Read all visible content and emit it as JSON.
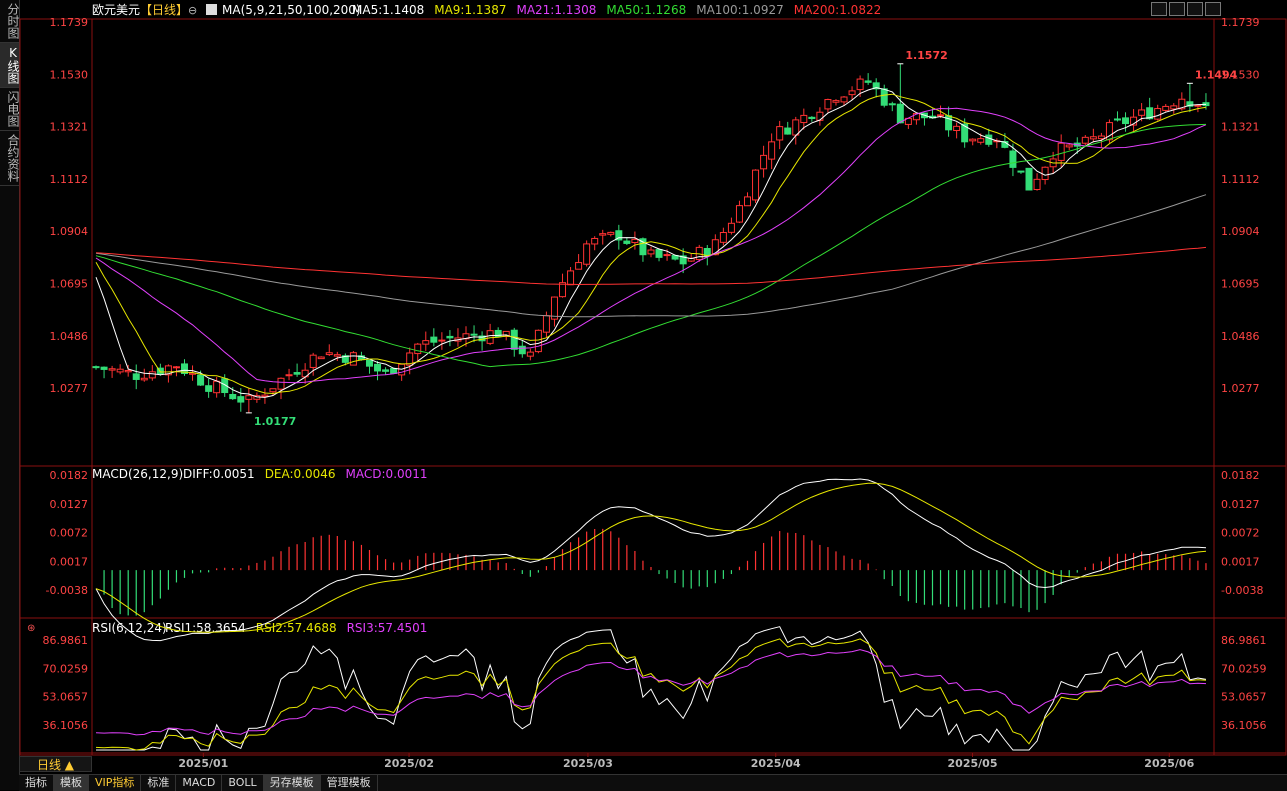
{
  "sidebar": {
    "tabs": [
      "分时图",
      "K线图",
      "闪电图",
      "合约资料"
    ]
  },
  "header": {
    "symbol": "欧元美元",
    "period_tag": "【日线】",
    "ma_params": "MA(5,9,21,50,100,200)",
    "ma_values": [
      {
        "text": "MA5:1.1408",
        "color": "#ffffff"
      },
      {
        "text": "MA9:1.1387",
        "color": "#e6e600"
      },
      {
        "text": "MA21:1.1308",
        "color": "#e040fb"
      },
      {
        "text": "MA50:1.1268",
        "color": "#33dd33"
      },
      {
        "text": "MA100:1.0927",
        "color": "#999999"
      },
      {
        "text": "MA200:1.0822",
        "color": "#ff3333"
      }
    ]
  },
  "macd_header": {
    "params": "MACD(26,12,9)",
    "items": [
      {
        "text": "DIFF:0.0051",
        "color": "#ffffff"
      },
      {
        "text": "DEA:0.0046",
        "color": "#e6e600"
      },
      {
        "text": "MACD:0.0011",
        "color": "#e040fb"
      }
    ]
  },
  "rsi_header": {
    "params": "RSI(6,12,24)",
    "items": [
      {
        "text": "RSI1:58.3654",
        "color": "#ffffff"
      },
      {
        "text": "RSI2:57.4688",
        "color": "#e6e600"
      },
      {
        "text": "RSI3:57.4501",
        "color": "#e040fb"
      }
    ]
  },
  "chart_data": [
    {
      "type": "candlestick",
      "y_ticks": [
        "1.1739",
        "1.1530",
        "1.1321",
        "1.1112",
        "1.0904",
        "1.0695",
        "1.0486",
        "1.0277"
      ],
      "ylim": [
        1.014,
        1.1739
      ],
      "annotations": [
        {
          "label": "1.1572",
          "value": 1.1572,
          "index": 100
        },
        {
          "label": "1.1494",
          "value": 1.1494,
          "index": 136
        },
        {
          "label": "1.0177",
          "value": 1.0177,
          "index": 19
        }
      ],
      "start_close": 1.036,
      "end_close": 1.1405,
      "colors": {
        "up": "#ff3333",
        "down": "#33dd77"
      }
    },
    {
      "type": "line",
      "name_text": "MACD",
      "y_ticks": [
        "0.0182",
        "0.0127",
        "0.0072",
        "0.0017",
        "-0.0038"
      ],
      "ylim": [
        -0.0045,
        0.0195
      ]
    },
    {
      "type": "line",
      "name_text": "RSI",
      "y_ticks": [
        "86.9861",
        "70.0259",
        "53.0657",
        "36.1056"
      ],
      "ylim": [
        30,
        90
      ]
    }
  ],
  "x_ticks": [
    {
      "label": "2025/01",
      "index": 12
    },
    {
      "label": "2025/02",
      "index": 35
    },
    {
      "label": "2025/03",
      "index": 55
    },
    {
      "label": "2025/04",
      "index": 76
    },
    {
      "label": "2025/05",
      "index": 98
    },
    {
      "label": "2025/06",
      "index": 120
    }
  ],
  "period_button": "日线 ▲",
  "bottom_tabs": [
    "指标",
    "模板",
    "VIP指标",
    "标准",
    "MACD",
    "BOLL",
    "另存模板",
    "管理模板"
  ]
}
